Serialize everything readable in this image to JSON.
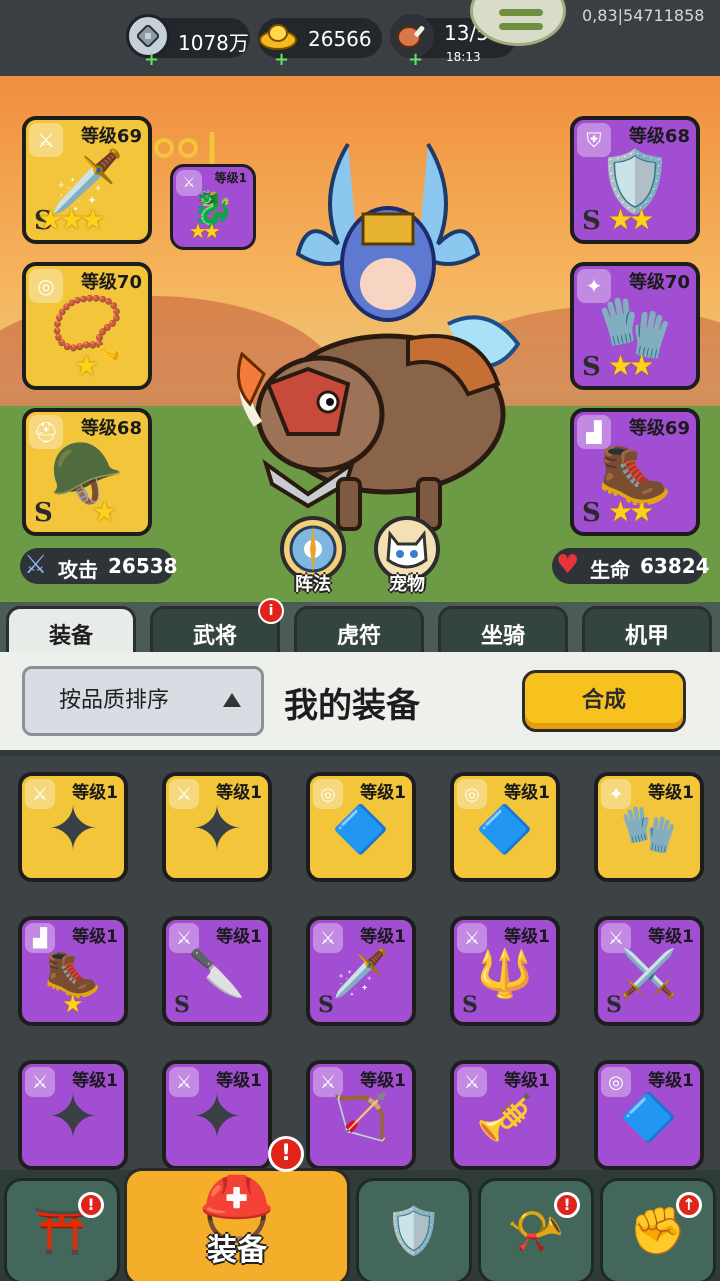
{
  "resources": [
    {
      "name": "silver",
      "value": "1078万",
      "icon": "silver-coin-icon"
    },
    {
      "name": "gold",
      "value": "26566",
      "icon": "gold-ingot-icon"
    },
    {
      "name": "stamina",
      "value": "13/50",
      "sub": "18:13",
      "icon": "meat-icon"
    }
  ],
  "coord_readout": "0,83|54711858",
  "equipped": {
    "left": [
      {
        "level": "等级69",
        "grade": "S",
        "stars": 3,
        "color": "gold",
        "icon": "sword-icon"
      },
      {
        "level": "等级70",
        "grade": "",
        "stars": 1,
        "color": "gold",
        "icon": "amulet-icon"
      },
      {
        "level": "等级68",
        "grade": "S",
        "stars": 1,
        "color": "gold",
        "icon": "helmet-icon"
      }
    ],
    "right": [
      {
        "level": "等级68",
        "grade": "S",
        "stars": 2,
        "color": "purple",
        "icon": "armor-icon"
      },
      {
        "level": "等级70",
        "grade": "S",
        "stars": 2,
        "color": "purple",
        "icon": "bracer-icon"
      },
      {
        "level": "等级69",
        "grade": "S",
        "stars": 2,
        "color": "purple",
        "icon": "boots-icon"
      }
    ],
    "linked": {
      "level": "等级1",
      "stars": 2,
      "icon": "dragon-icon"
    }
  },
  "stats": {
    "attack_label": "攻击",
    "attack_value": "26538",
    "hp_label": "生命",
    "hp_value": "63824"
  },
  "round_buttons": {
    "formation": "阵法",
    "pet": "宠物"
  },
  "tabs": [
    {
      "label": "装备",
      "active": true,
      "badge": false
    },
    {
      "label": "武将",
      "active": false,
      "badge": true
    },
    {
      "label": "虎符",
      "active": false,
      "badge": false
    },
    {
      "label": "坐骑",
      "active": false,
      "badge": false
    },
    {
      "label": "机甲",
      "active": false,
      "badge": false
    }
  ],
  "panel": {
    "sort_label": "按品质排序",
    "title": "我的装备",
    "merge_label": "合成"
  },
  "inventory": [
    {
      "level": "等级1",
      "color": "gold",
      "grade": "",
      "stars": 0,
      "icon": "shuriken-icon",
      "type": "sword-icon"
    },
    {
      "level": "等级1",
      "color": "gold",
      "grade": "",
      "stars": 0,
      "icon": "shuriken-icon",
      "type": "sword-icon"
    },
    {
      "level": "等级1",
      "color": "gold",
      "grade": "",
      "stars": 0,
      "icon": "pendant-icon",
      "type": "amulet-icon"
    },
    {
      "level": "等级1",
      "color": "gold",
      "grade": "",
      "stars": 0,
      "icon": "pendant-icon",
      "type": "amulet-icon"
    },
    {
      "level": "等级1",
      "color": "gold",
      "grade": "",
      "stars": 0,
      "icon": "bracer-icon",
      "type": "bracer-icon"
    },
    {
      "level": "等级1",
      "color": "purple",
      "grade": "",
      "stars": 1,
      "icon": "boots-icon",
      "type": "boots-icon"
    },
    {
      "level": "等级1",
      "color": "purple",
      "grade": "S",
      "stars": 0,
      "icon": "curved-blade-icon",
      "type": "sword-icon"
    },
    {
      "level": "等级1",
      "color": "purple",
      "grade": "S",
      "stars": 0,
      "icon": "ice-sword-icon",
      "type": "sword-icon"
    },
    {
      "level": "等级1",
      "color": "purple",
      "grade": "S",
      "stars": 0,
      "icon": "spear-icon",
      "type": "sword-icon"
    },
    {
      "level": "等级1",
      "color": "purple",
      "grade": "S",
      "stars": 0,
      "icon": "crossed-swords-icon",
      "type": "sword-icon"
    },
    {
      "level": "等级1",
      "color": "purple",
      "grade": "",
      "stars": 0,
      "icon": "shuriken-icon",
      "type": "sword-icon"
    },
    {
      "level": "等级1",
      "color": "purple",
      "grade": "",
      "stars": 0,
      "icon": "shuriken-icon",
      "type": "sword-icon"
    },
    {
      "level": "等级1",
      "color": "purple",
      "grade": "",
      "stars": 0,
      "icon": "crossbow-icon",
      "type": "sword-icon"
    },
    {
      "level": "等级1",
      "color": "purple",
      "grade": "",
      "stars": 0,
      "icon": "flute-icon",
      "type": "sword-icon"
    },
    {
      "level": "等级1",
      "color": "purple",
      "grade": "",
      "stars": 0,
      "icon": "pendant-icon",
      "type": "amulet-icon"
    }
  ],
  "bottom_nav": [
    {
      "label": "",
      "icon": "gate-icon",
      "badge": "!"
    },
    {
      "label": "装备",
      "icon": "helmet-icon",
      "badge": "!",
      "active": true
    },
    {
      "label": "",
      "icon": "shield-swords-icon",
      "badge": ""
    },
    {
      "label": "",
      "icon": "horn-icon",
      "badge": "!"
    },
    {
      "label": "",
      "icon": "fist-upgrade-icon",
      "badge": "↑"
    }
  ],
  "colors": {
    "gold_card": "#f2c53a",
    "purple_card": "#a24ed2",
    "badge_red": "#e0231b",
    "merge_yellow": "#f7c21e",
    "active_nav": "#f5ae2a"
  }
}
